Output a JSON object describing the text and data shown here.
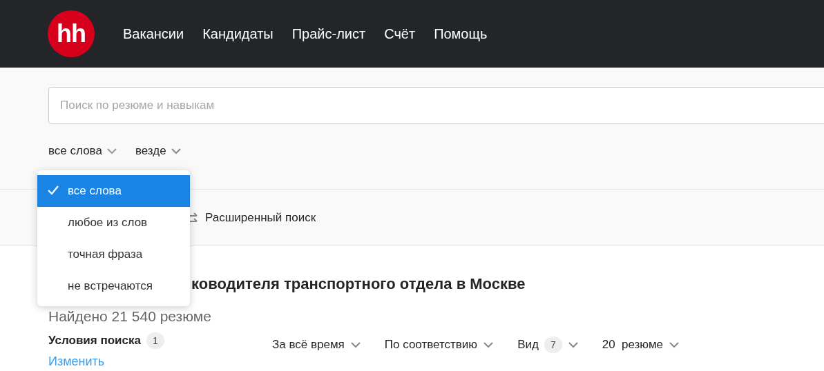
{
  "header": {
    "logo": "hh",
    "nav": [
      "Вакансии",
      "Кандидаты",
      "Прайс-лист",
      "Счёт",
      "Помощь"
    ]
  },
  "search": {
    "placeholder": "Поиск по резюме и навыкам",
    "options": [
      {
        "label": "все слова",
        "expanded": true
      },
      {
        "label": "везде",
        "expanded": false
      }
    ]
  },
  "match_menu": [
    {
      "label": "все слова",
      "selected": true
    },
    {
      "label": "любое из слов",
      "selected": false
    },
    {
      "label": "точная фраза",
      "selected": false
    },
    {
      "label": "не встречаются",
      "selected": false
    }
  ],
  "advanced_search": "Расширенный поиск",
  "results": {
    "heading": "ководителя транспортного отдела в Москве",
    "found": "Найдено 21 540 резюме",
    "conditions": {
      "label": "Условия поиска",
      "count": "1"
    },
    "change_link": "Изменить",
    "sort": [
      {
        "label": "За всё время"
      },
      {
        "label": "По соответствию"
      },
      {
        "label": "Вид",
        "badge": "7"
      },
      {
        "label": "20  резюме"
      }
    ]
  }
}
